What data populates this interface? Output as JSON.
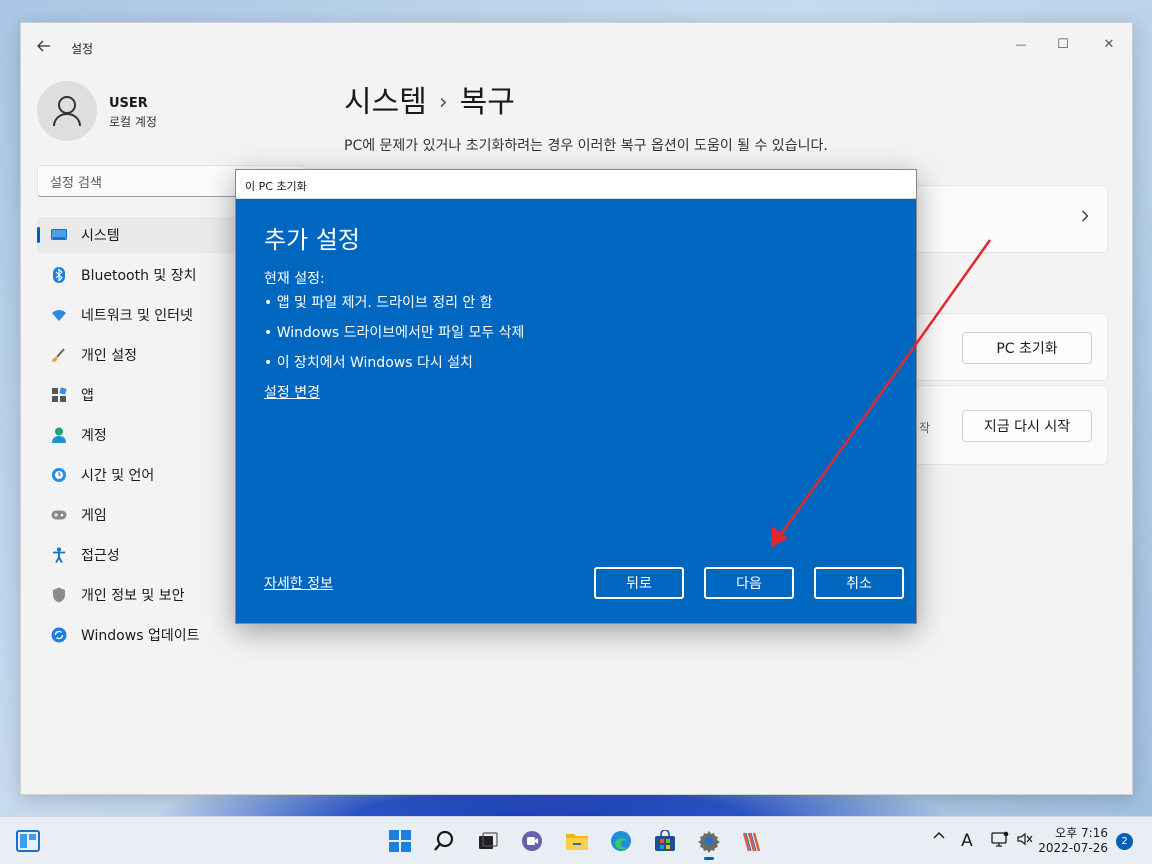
{
  "window": {
    "app_title": "설정",
    "controls": {
      "minimize": "—",
      "maximize": "☐",
      "close": "✕"
    }
  },
  "user": {
    "name": "USER",
    "account_type": "로컬 계정"
  },
  "search": {
    "placeholder": "설정 검색"
  },
  "sidebar": {
    "items": [
      {
        "label": "시스템",
        "icon": "system-icon",
        "active": true
      },
      {
        "label": "Bluetooth 및 장치",
        "icon": "bluetooth-icon"
      },
      {
        "label": "네트워크 및 인터넷",
        "icon": "wifi-icon"
      },
      {
        "label": "개인 설정",
        "icon": "personalization-icon"
      },
      {
        "label": "앱",
        "icon": "apps-icon"
      },
      {
        "label": "계정",
        "icon": "account-icon"
      },
      {
        "label": "시간 및 언어",
        "icon": "time-language-icon"
      },
      {
        "label": "게임",
        "icon": "gaming-icon"
      },
      {
        "label": "접근성",
        "icon": "accessibility-icon"
      },
      {
        "label": "개인 정보 및 보안",
        "icon": "privacy-shield-icon"
      },
      {
        "label": "Windows 업데이트",
        "icon": "windows-update-icon"
      }
    ]
  },
  "main": {
    "breadcrumb_parent": "시스템",
    "breadcrumb_separator": "›",
    "breadcrumb_current": "복구",
    "description": "PC에 문제가 있거나 초기화하려는 경우 이러한 복구 옵션이 도움이 될 수 있습니다.",
    "reset_button": "PC 초기화",
    "restart_button": "지금 다시 시작",
    "partial_text": "작"
  },
  "dialog": {
    "title": "이 PC 초기화",
    "heading": "추가 설정",
    "current_label": "현재 설정:",
    "bullets": [
      "• 앱 및 파일 제거. 드라이브 정리 안 함",
      "• Windows 드라이브에서만 파일 모두 삭제",
      "• 이 장치에서 Windows 다시 설치"
    ],
    "change_link": "설정 변경",
    "more_info_link": "자세한 정보",
    "back_button": "뒤로",
    "next_button": "다음",
    "cancel_button": "취소"
  },
  "annotation": {
    "arrow_color": "#e0282e"
  },
  "taskbar": {
    "ime_label": "A",
    "time": "오후 7:16",
    "date": "2022-07-26",
    "notification_count": "2"
  },
  "colors": {
    "accent": "#005fb8",
    "dialog_blue": "#0067c0"
  }
}
